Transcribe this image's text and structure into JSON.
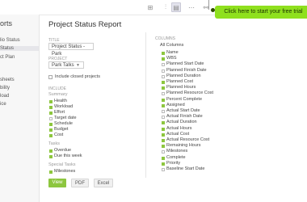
{
  "topbar": {
    "icons": [
      "zoom-icon",
      "filter-icon",
      "report-icon",
      "more-icon",
      "share-icon"
    ],
    "trial_cta": "Click here to start your free trial"
  },
  "sidebar": {
    "title": "orts",
    "items": [
      {
        "label": "lio Status"
      },
      {
        "label": "Status"
      },
      {
        "label": "ct Plan"
      },
      {
        "label": "sheets"
      },
      {
        "label": "bility"
      },
      {
        "label": "load"
      },
      {
        "label": "ice"
      }
    ]
  },
  "report": {
    "title": "Project Status Report",
    "title_label": "Title",
    "title_value": "Project Status - Park",
    "project_label": "Project",
    "project_value": "Park Talks",
    "closed_projects_label": "Include closed projects",
    "include_label": "Include",
    "summary_label": "Summary",
    "summary_items": [
      {
        "label": "Health",
        "checked": true
      },
      {
        "label": "Workload",
        "checked": true
      },
      {
        "label": "Effort",
        "checked": true
      },
      {
        "label": "Target date",
        "checked": false
      },
      {
        "label": "Schedule",
        "checked": true
      },
      {
        "label": "Budget",
        "checked": true
      },
      {
        "label": "Cost",
        "checked": true
      }
    ],
    "tasks_label": "Tasks",
    "tasks_items": [
      {
        "label": "Overdue",
        "checked": true
      },
      {
        "label": "Due this week",
        "checked": true
      }
    ],
    "special_tasks_label": "Special Tasks",
    "special_items": [
      {
        "label": "Milestones",
        "checked": true
      }
    ],
    "buttons": {
      "view": "View",
      "pdf": "PDF",
      "excel": "Excel"
    }
  },
  "columns": {
    "label": "Columns",
    "all_label": "All Columns",
    "items": [
      {
        "label": "Name",
        "checked": true
      },
      {
        "label": "WBS",
        "checked": true
      },
      {
        "label": "Planned Start Date",
        "checked": false
      },
      {
        "label": "Planned Finish Date",
        "checked": false
      },
      {
        "label": "Planned Duration",
        "checked": false
      },
      {
        "label": "Planned Cost",
        "checked": true
      },
      {
        "label": "Planned Hours",
        "checked": true
      },
      {
        "label": "Planned Resource Cost",
        "checked": false
      },
      {
        "label": "Percent Complete",
        "checked": true
      },
      {
        "label": "Assigned",
        "checked": true
      },
      {
        "label": "Actual Start Date",
        "checked": false
      },
      {
        "label": "Actual Finish Date",
        "checked": false
      },
      {
        "label": "Actual Duration",
        "checked": true
      },
      {
        "label": "Actual Hours",
        "checked": true
      },
      {
        "label": "Actual Cost",
        "checked": true
      },
      {
        "label": "Actual Resource Cost",
        "checked": true
      },
      {
        "label": "Remaining Hours",
        "checked": true
      },
      {
        "label": "Milestones",
        "checked": false
      },
      {
        "label": "Complete",
        "checked": true
      },
      {
        "label": "Priority",
        "checked": true
      },
      {
        "label": "Baseline Start Date",
        "checked": false
      }
    ]
  },
  "colors": {
    "accent": "#8dc63f",
    "trial": "#8fe01e"
  }
}
